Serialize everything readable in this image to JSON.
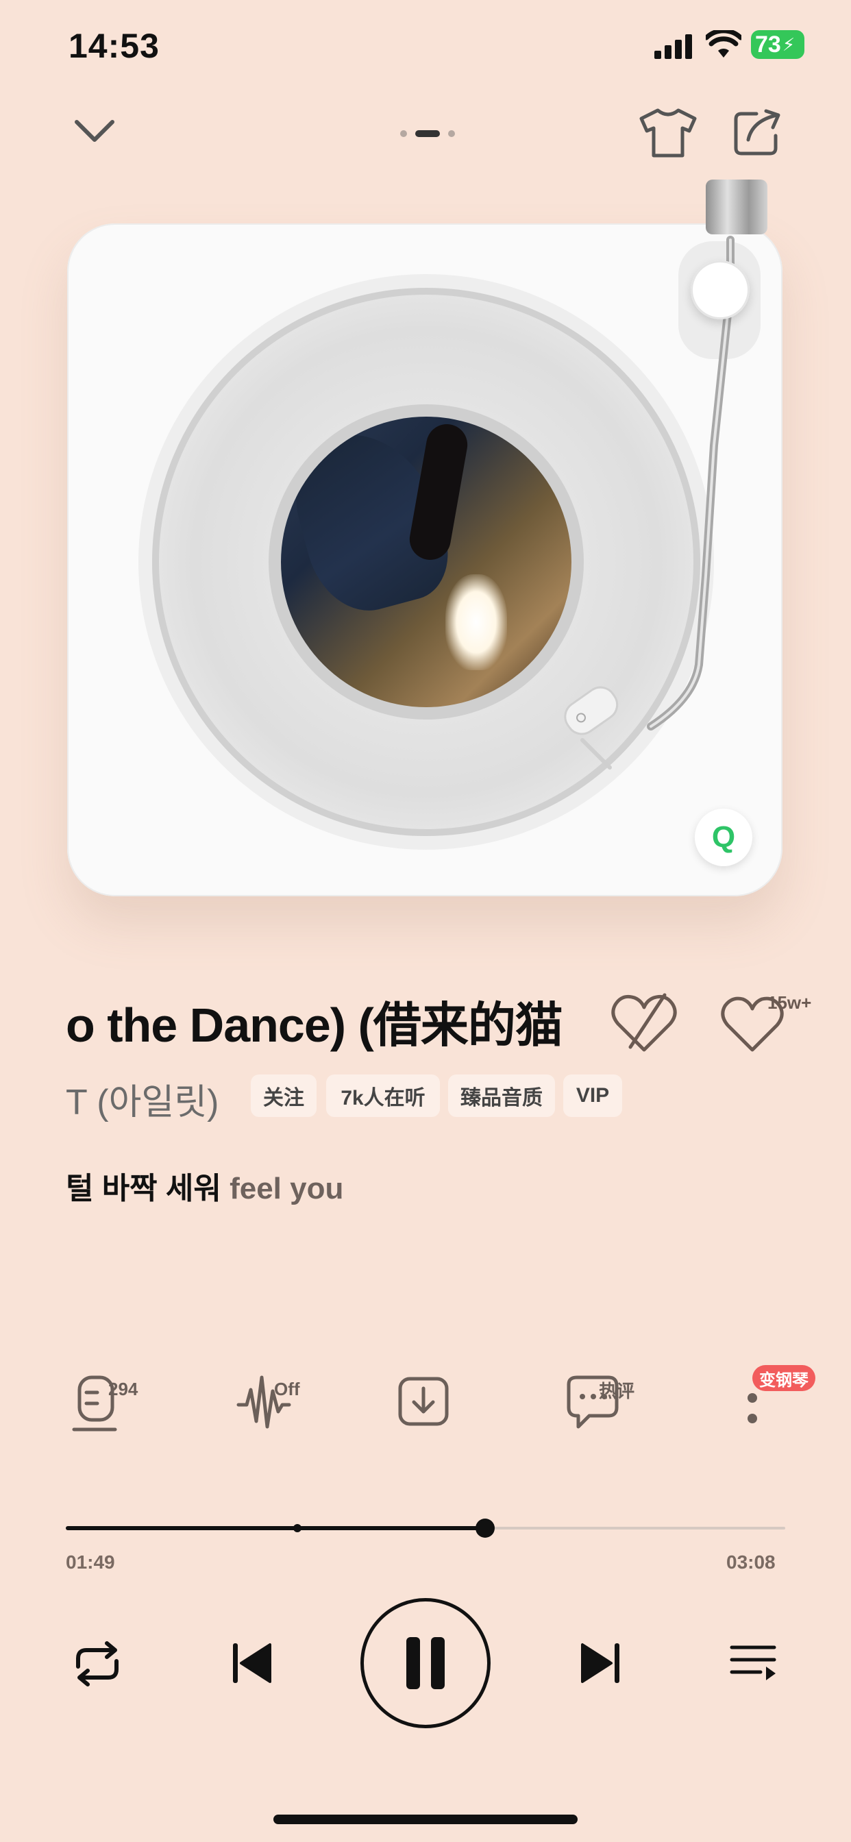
{
  "status_bar": {
    "time": "14:53",
    "battery": "73"
  },
  "header": {
    "icons": [
      "chevron-down-icon",
      "pager-dots",
      "tshirt-icon",
      "share-icon"
    ]
  },
  "player": {
    "title": "o the Dance) (借来的猫",
    "artist": "T (아일릿)",
    "like_count": "15w+",
    "tags": {
      "follow": "关注",
      "listeners": "7k人在听",
      "quality": "臻品音质",
      "vip": "VIP"
    },
    "lyric_highlight": "털 바짝 세워",
    "lyric_rest": " feel you",
    "badge_letter": "Q"
  },
  "actions": {
    "mic_count": "294",
    "wave_state": "Off",
    "comment_label": "热评",
    "piano_badge": "变钢琴"
  },
  "progress": {
    "elapsed": "01:49",
    "duration": "03:08",
    "fraction": 0.583
  },
  "colors": {
    "background": "#f9e3d7",
    "accent": "#111111",
    "badge_red": "#f25c5c",
    "qq_green": "#2ec467"
  }
}
